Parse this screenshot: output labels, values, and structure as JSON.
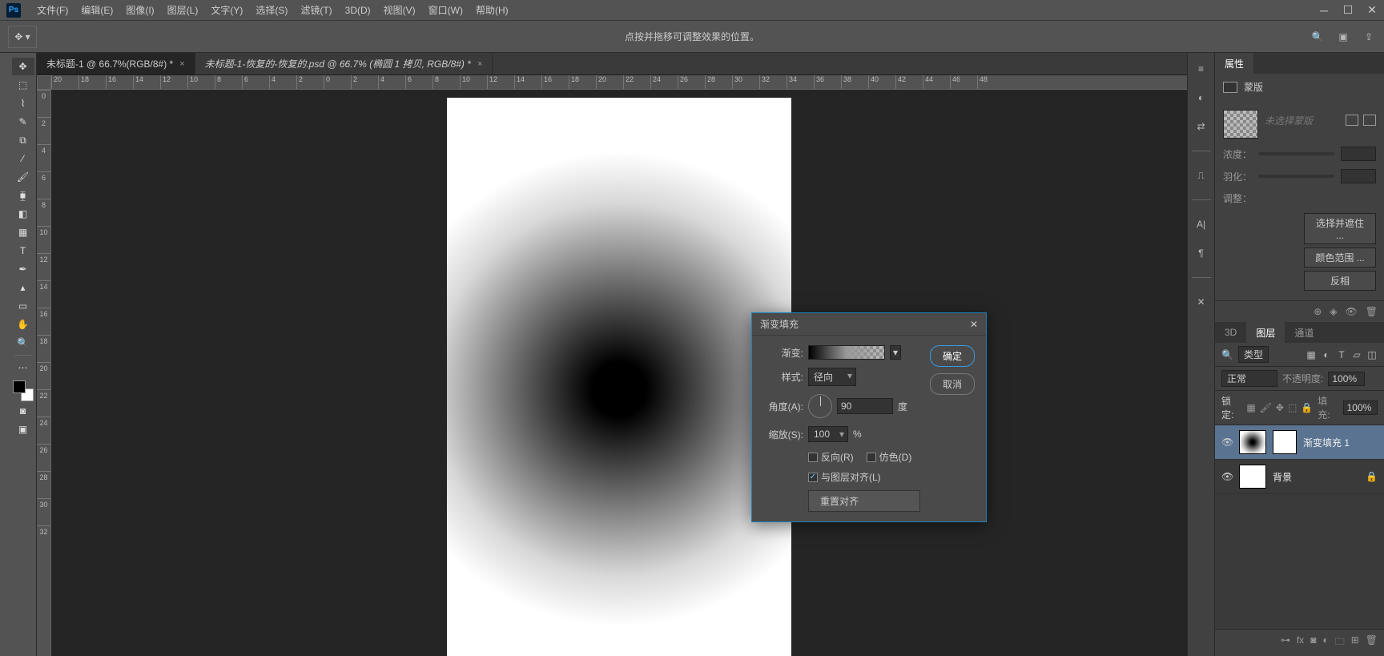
{
  "menu": {
    "items": [
      "文件(F)",
      "编辑(E)",
      "图像(I)",
      "图层(L)",
      "文字(Y)",
      "选择(S)",
      "滤镜(T)",
      "3D(D)",
      "视图(V)",
      "窗口(W)",
      "帮助(H)"
    ]
  },
  "options": {
    "hint": "点按并拖移可调整效果的位置。"
  },
  "tabs": [
    {
      "label": "未标题-1 @ 66.7%(RGB/8#) *",
      "active": true
    },
    {
      "label": "未标题-1-恢复的-恢复的.psd @ 66.7% (椭圆 1 拷贝, RGB/8#) *",
      "active": false
    }
  ],
  "ruler_h": [
    "20",
    "18",
    "16",
    "14",
    "12",
    "10",
    "8",
    "6",
    "4",
    "2",
    "0",
    "2",
    "4",
    "6",
    "8",
    "10",
    "12",
    "14",
    "16",
    "18",
    "20",
    "22",
    "24",
    "26",
    "28",
    "30",
    "32",
    "34",
    "36",
    "38",
    "40",
    "42",
    "44",
    "46",
    "48"
  ],
  "ruler_v": [
    "0",
    "2",
    "4",
    "6",
    "8",
    "10",
    "12",
    "14",
    "16",
    "18",
    "20",
    "22",
    "24",
    "26",
    "28",
    "30",
    "32"
  ],
  "propPanel": {
    "tab": "属性",
    "maskLabel": "蒙版",
    "selectedLabel": "未选择蒙版",
    "density": "浓度：",
    "feather": "羽化：",
    "adjust": "调整：",
    "btnSelect": "选择并遮住 ...",
    "btnColor": "颜色范围 ...",
    "btnInvert": "反相"
  },
  "layersPanel": {
    "tabs": [
      "3D",
      "图层",
      "通道"
    ],
    "kind": "类型",
    "blend": "正常",
    "opacityLabel": "不透明度:",
    "opacity": "100%",
    "lockLabel": "锁定:",
    "fillLabel": "填充:",
    "fill": "100%",
    "layers": [
      {
        "name": "渐变填充 1",
        "active": true,
        "grad": true,
        "hasMask": true
      },
      {
        "name": "背景",
        "active": false,
        "locked": true
      }
    ]
  },
  "dialog": {
    "title": "渐变填充",
    "gradient": "渐变:",
    "style": "样式:",
    "styleVal": "径向",
    "angle": "角度(A):",
    "angleVal": "90",
    "angleUnit": "度",
    "scale": "缩放(S):",
    "scaleVal": "100",
    "scaleUnit": "%",
    "reverse": "反向(R)",
    "dither": "仿色(D)",
    "align": "与图层对齐(L)",
    "reset": "重置对齐",
    "ok": "确定",
    "cancel": "取消"
  }
}
